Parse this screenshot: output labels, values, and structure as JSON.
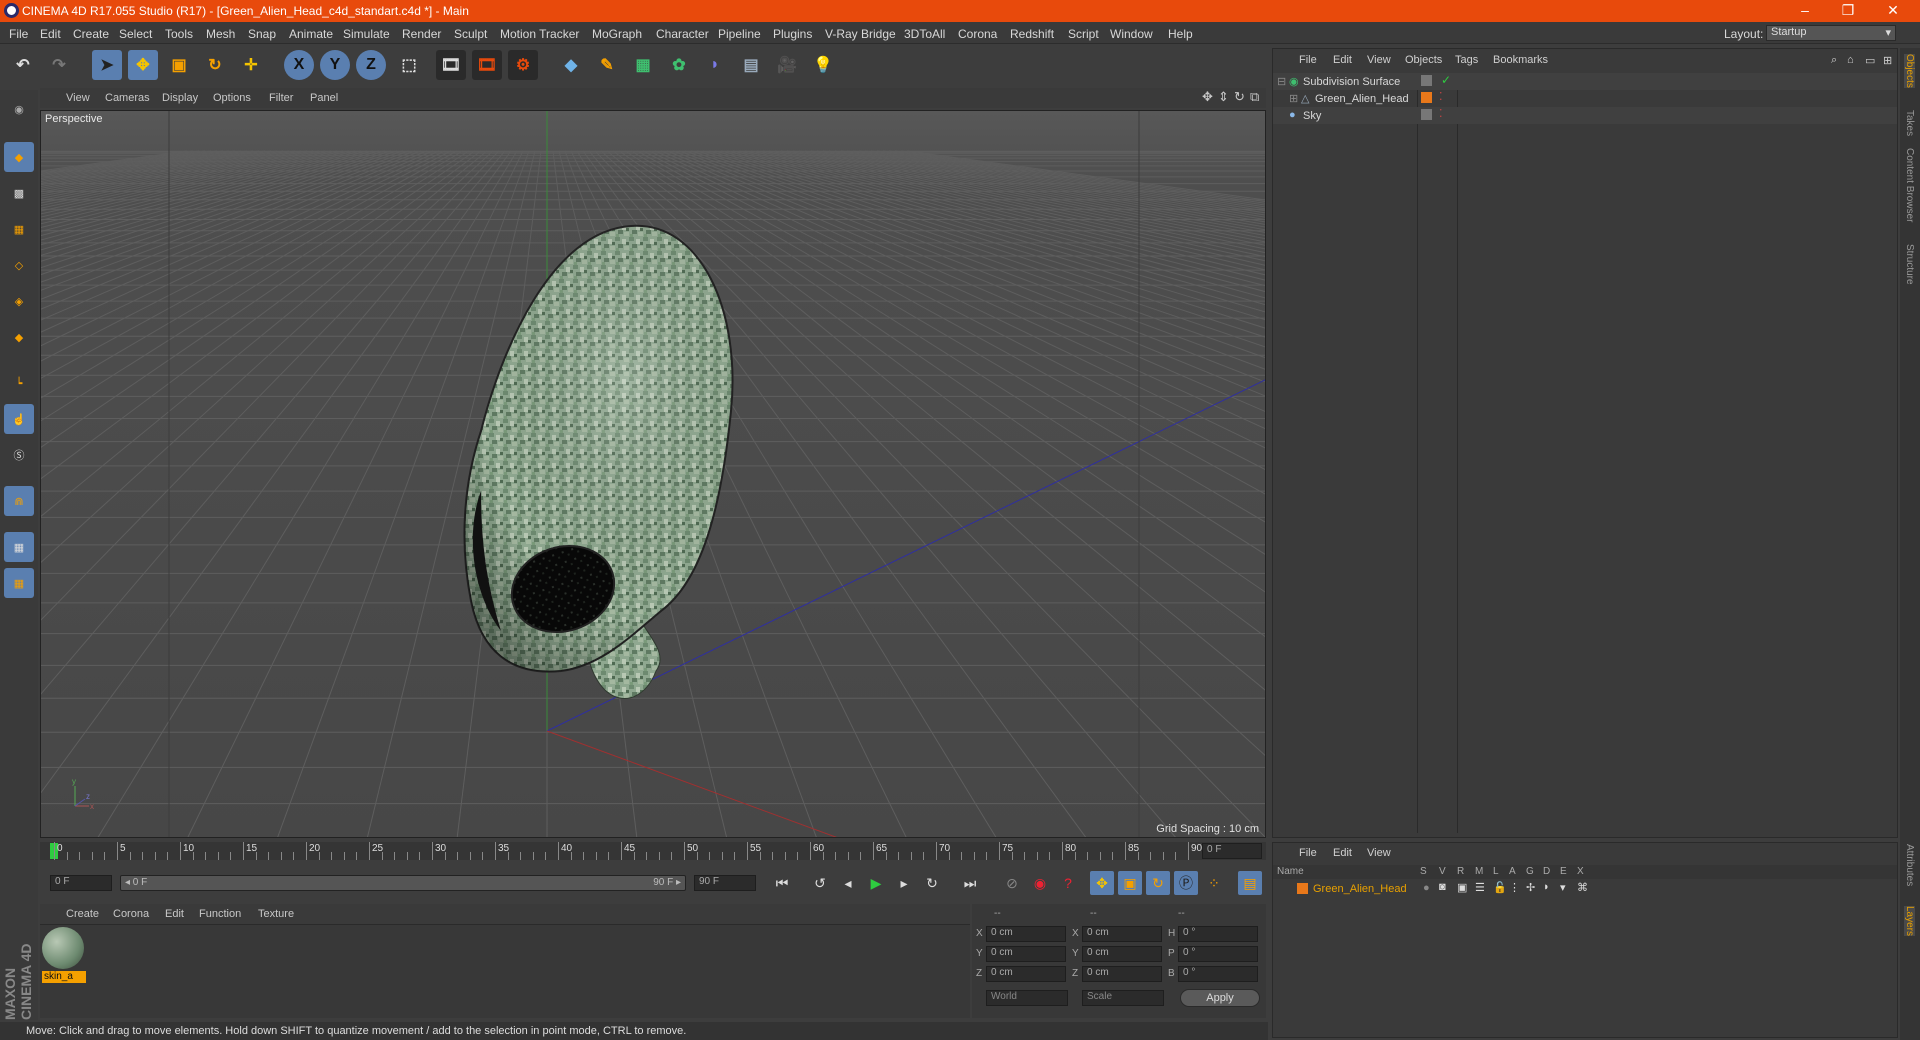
{
  "window": {
    "title": "CINEMA 4D R17.055 Studio (R17) - [Green_Alien_Head_c4d_standart.c4d *] - Main",
    "controls": [
      "–",
      "❐",
      "✕"
    ]
  },
  "menu": [
    "File",
    "Edit",
    "Create",
    "Select",
    "Tools",
    "Mesh",
    "Snap",
    "Animate",
    "Simulate",
    "Render",
    "Sculpt",
    "Motion Tracker",
    "MoGraph",
    "Character",
    "Pipeline",
    "Plugins",
    "V-Ray Bridge",
    "3DToAll",
    "Corona",
    "Redshift",
    "Script",
    "Window",
    "Help"
  ],
  "layout": {
    "label": "Layout:",
    "value": "Startup"
  },
  "toolbar": {
    "axis_x": "X",
    "axis_y": "Y",
    "axis_z": "Z"
  },
  "viewport": {
    "menu": [
      "View",
      "Cameras",
      "Display",
      "Options",
      "Filter",
      "Panel"
    ],
    "label": "Perspective",
    "grid_spacing": "Grid Spacing : 10 cm"
  },
  "timeline": {
    "ticks": [
      "0",
      "5",
      "10",
      "15",
      "20",
      "25",
      "30",
      "35",
      "40",
      "45",
      "50",
      "55",
      "60",
      "65",
      "70",
      "75",
      "80",
      "85",
      "90"
    ],
    "frame_end_field": "0 F",
    "start_field": "0 F",
    "slider_left": "◂ 0 F",
    "slider_right": "90 F ▸",
    "end_field": "90 F"
  },
  "material_manager": {
    "menu": [
      "Create",
      "Corona",
      "Edit",
      "Function",
      "Texture"
    ],
    "materials": [
      {
        "name": "skin_a"
      }
    ]
  },
  "coordinates": {
    "headers": [
      "--",
      "--",
      "--"
    ],
    "rows": [
      {
        "l1": "X",
        "v1": "0 cm",
        "l2": "X",
        "v2": "0 cm",
        "l3": "H",
        "v3": "0 °"
      },
      {
        "l1": "Y",
        "v1": "0 cm",
        "l2": "Y",
        "v2": "0 cm",
        "l3": "P",
        "v3": "0 °"
      },
      {
        "l1": "Z",
        "v1": "0 cm",
        "l2": "Z",
        "v2": "0 cm",
        "l3": "B",
        "v3": "0 °"
      }
    ],
    "mode_world": "World",
    "mode_scale": "Scale",
    "apply": "Apply"
  },
  "status": "Move: Click and drag to move elements. Hold down SHIFT to quantize movement / add to the selection in point mode, CTRL to remove.",
  "branding": "MAXON CINEMA 4D",
  "object_manager": {
    "menu": [
      "File",
      "Edit",
      "View",
      "Objects",
      "Tags",
      "Bookmarks"
    ],
    "objects": [
      {
        "name": "Subdivision Surface"
      },
      {
        "name": "Green_Alien_Head"
      },
      {
        "name": "Sky"
      }
    ]
  },
  "layer_manager": {
    "menu": [
      "File",
      "Edit",
      "View"
    ],
    "col_name": "Name",
    "cols": [
      "S",
      "V",
      "R",
      "M",
      "L",
      "A",
      "G",
      "D",
      "E",
      "X"
    ],
    "layers": [
      {
        "name": "Green_Alien_Head"
      }
    ]
  },
  "right_tabs": [
    "Objects",
    "Takes",
    "Content Browser",
    "Structure"
  ],
  "right_tabs_bottom": [
    "Attributes",
    "Layers"
  ],
  "colors": {
    "accent": "#e84a0c",
    "select_blue": "#5a7fb0",
    "layer_orange": "#e8781a"
  }
}
